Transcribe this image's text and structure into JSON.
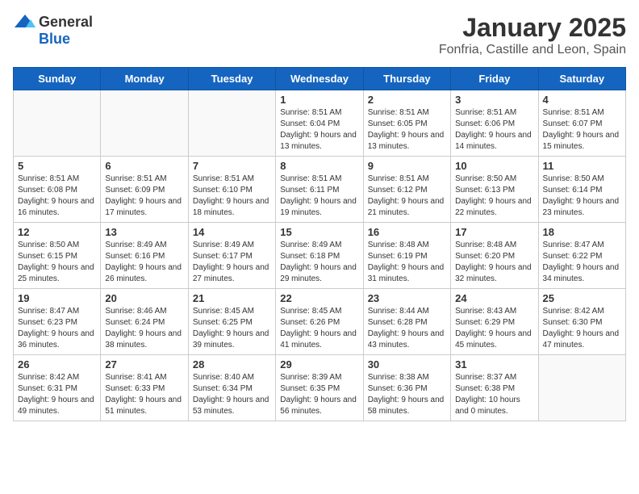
{
  "logo": {
    "general": "General",
    "blue": "Blue"
  },
  "title": "January 2025",
  "subtitle": "Fonfria, Castille and Leon, Spain",
  "weekdays": [
    "Sunday",
    "Monday",
    "Tuesday",
    "Wednesday",
    "Thursday",
    "Friday",
    "Saturday"
  ],
  "weeks": [
    [
      {
        "day": "",
        "info": ""
      },
      {
        "day": "",
        "info": ""
      },
      {
        "day": "",
        "info": ""
      },
      {
        "day": "1",
        "info": "Sunrise: 8:51 AM\nSunset: 6:04 PM\nDaylight: 9 hours and 13 minutes."
      },
      {
        "day": "2",
        "info": "Sunrise: 8:51 AM\nSunset: 6:05 PM\nDaylight: 9 hours and 13 minutes."
      },
      {
        "day": "3",
        "info": "Sunrise: 8:51 AM\nSunset: 6:06 PM\nDaylight: 9 hours and 14 minutes."
      },
      {
        "day": "4",
        "info": "Sunrise: 8:51 AM\nSunset: 6:07 PM\nDaylight: 9 hours and 15 minutes."
      }
    ],
    [
      {
        "day": "5",
        "info": "Sunrise: 8:51 AM\nSunset: 6:08 PM\nDaylight: 9 hours and 16 minutes."
      },
      {
        "day": "6",
        "info": "Sunrise: 8:51 AM\nSunset: 6:09 PM\nDaylight: 9 hours and 17 minutes."
      },
      {
        "day": "7",
        "info": "Sunrise: 8:51 AM\nSunset: 6:10 PM\nDaylight: 9 hours and 18 minutes."
      },
      {
        "day": "8",
        "info": "Sunrise: 8:51 AM\nSunset: 6:11 PM\nDaylight: 9 hours and 19 minutes."
      },
      {
        "day": "9",
        "info": "Sunrise: 8:51 AM\nSunset: 6:12 PM\nDaylight: 9 hours and 21 minutes."
      },
      {
        "day": "10",
        "info": "Sunrise: 8:50 AM\nSunset: 6:13 PM\nDaylight: 9 hours and 22 minutes."
      },
      {
        "day": "11",
        "info": "Sunrise: 8:50 AM\nSunset: 6:14 PM\nDaylight: 9 hours and 23 minutes."
      }
    ],
    [
      {
        "day": "12",
        "info": "Sunrise: 8:50 AM\nSunset: 6:15 PM\nDaylight: 9 hours and 25 minutes."
      },
      {
        "day": "13",
        "info": "Sunrise: 8:49 AM\nSunset: 6:16 PM\nDaylight: 9 hours and 26 minutes."
      },
      {
        "day": "14",
        "info": "Sunrise: 8:49 AM\nSunset: 6:17 PM\nDaylight: 9 hours and 27 minutes."
      },
      {
        "day": "15",
        "info": "Sunrise: 8:49 AM\nSunset: 6:18 PM\nDaylight: 9 hours and 29 minutes."
      },
      {
        "day": "16",
        "info": "Sunrise: 8:48 AM\nSunset: 6:19 PM\nDaylight: 9 hours and 31 minutes."
      },
      {
        "day": "17",
        "info": "Sunrise: 8:48 AM\nSunset: 6:20 PM\nDaylight: 9 hours and 32 minutes."
      },
      {
        "day": "18",
        "info": "Sunrise: 8:47 AM\nSunset: 6:22 PM\nDaylight: 9 hours and 34 minutes."
      }
    ],
    [
      {
        "day": "19",
        "info": "Sunrise: 8:47 AM\nSunset: 6:23 PM\nDaylight: 9 hours and 36 minutes."
      },
      {
        "day": "20",
        "info": "Sunrise: 8:46 AM\nSunset: 6:24 PM\nDaylight: 9 hours and 38 minutes."
      },
      {
        "day": "21",
        "info": "Sunrise: 8:45 AM\nSunset: 6:25 PM\nDaylight: 9 hours and 39 minutes."
      },
      {
        "day": "22",
        "info": "Sunrise: 8:45 AM\nSunset: 6:26 PM\nDaylight: 9 hours and 41 minutes."
      },
      {
        "day": "23",
        "info": "Sunrise: 8:44 AM\nSunset: 6:28 PM\nDaylight: 9 hours and 43 minutes."
      },
      {
        "day": "24",
        "info": "Sunrise: 8:43 AM\nSunset: 6:29 PM\nDaylight: 9 hours and 45 minutes."
      },
      {
        "day": "25",
        "info": "Sunrise: 8:42 AM\nSunset: 6:30 PM\nDaylight: 9 hours and 47 minutes."
      }
    ],
    [
      {
        "day": "26",
        "info": "Sunrise: 8:42 AM\nSunset: 6:31 PM\nDaylight: 9 hours and 49 minutes."
      },
      {
        "day": "27",
        "info": "Sunrise: 8:41 AM\nSunset: 6:33 PM\nDaylight: 9 hours and 51 minutes."
      },
      {
        "day": "28",
        "info": "Sunrise: 8:40 AM\nSunset: 6:34 PM\nDaylight: 9 hours and 53 minutes."
      },
      {
        "day": "29",
        "info": "Sunrise: 8:39 AM\nSunset: 6:35 PM\nDaylight: 9 hours and 56 minutes."
      },
      {
        "day": "30",
        "info": "Sunrise: 8:38 AM\nSunset: 6:36 PM\nDaylight: 9 hours and 58 minutes."
      },
      {
        "day": "31",
        "info": "Sunrise: 8:37 AM\nSunset: 6:38 PM\nDaylight: 10 hours and 0 minutes."
      },
      {
        "day": "",
        "info": ""
      }
    ]
  ]
}
